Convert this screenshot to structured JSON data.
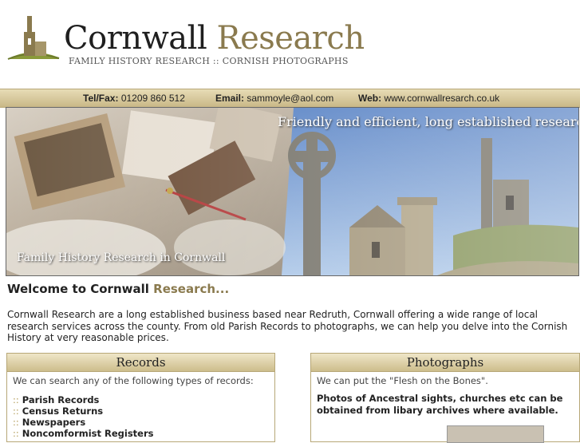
{
  "header": {
    "brand_word1": "Cornwall",
    "brand_word2": "Research",
    "tagline": "FAMILY HISTORY RESEARCH :: CORNISH PHOTOGRAPHS"
  },
  "contact": {
    "tel_label": "Tel/Fax:",
    "tel_value": "01209 860 512",
    "email_label": "Email:",
    "email_value": "sammoyle@aol.com",
    "web_label": "Web:",
    "web_value": "www.cornwallresarch.co.uk"
  },
  "banner": {
    "headline": "Friendly and efficient, long established researcher.",
    "caption": "Family History Research in Cornwall"
  },
  "welcome": {
    "title_part1": "Welcome to Cornwall",
    "title_part2": "Research..."
  },
  "intro": "Cornwall Research are a long established business based near Redruth, Cornwall offering a wide range of local research services across the county. From old Parish Records to photographs, we can help you delve into the Cornish History at very reasonable prices.",
  "records": {
    "title": "Records",
    "subtitle": "We can search any of the following types of records:",
    "items": [
      "Parish Records",
      "Census Returns",
      "Newspapers",
      "Noncomformist Registers"
    ]
  },
  "photographs": {
    "title": "Photographs",
    "subtitle": "We can put the \"Flesh on the Bones\".",
    "body": "Photos of Ancestral sights, churches etc can be obtained from libary archives where available."
  },
  "colors": {
    "accent": "#8a7a4e",
    "bar": "#d6c89a"
  }
}
